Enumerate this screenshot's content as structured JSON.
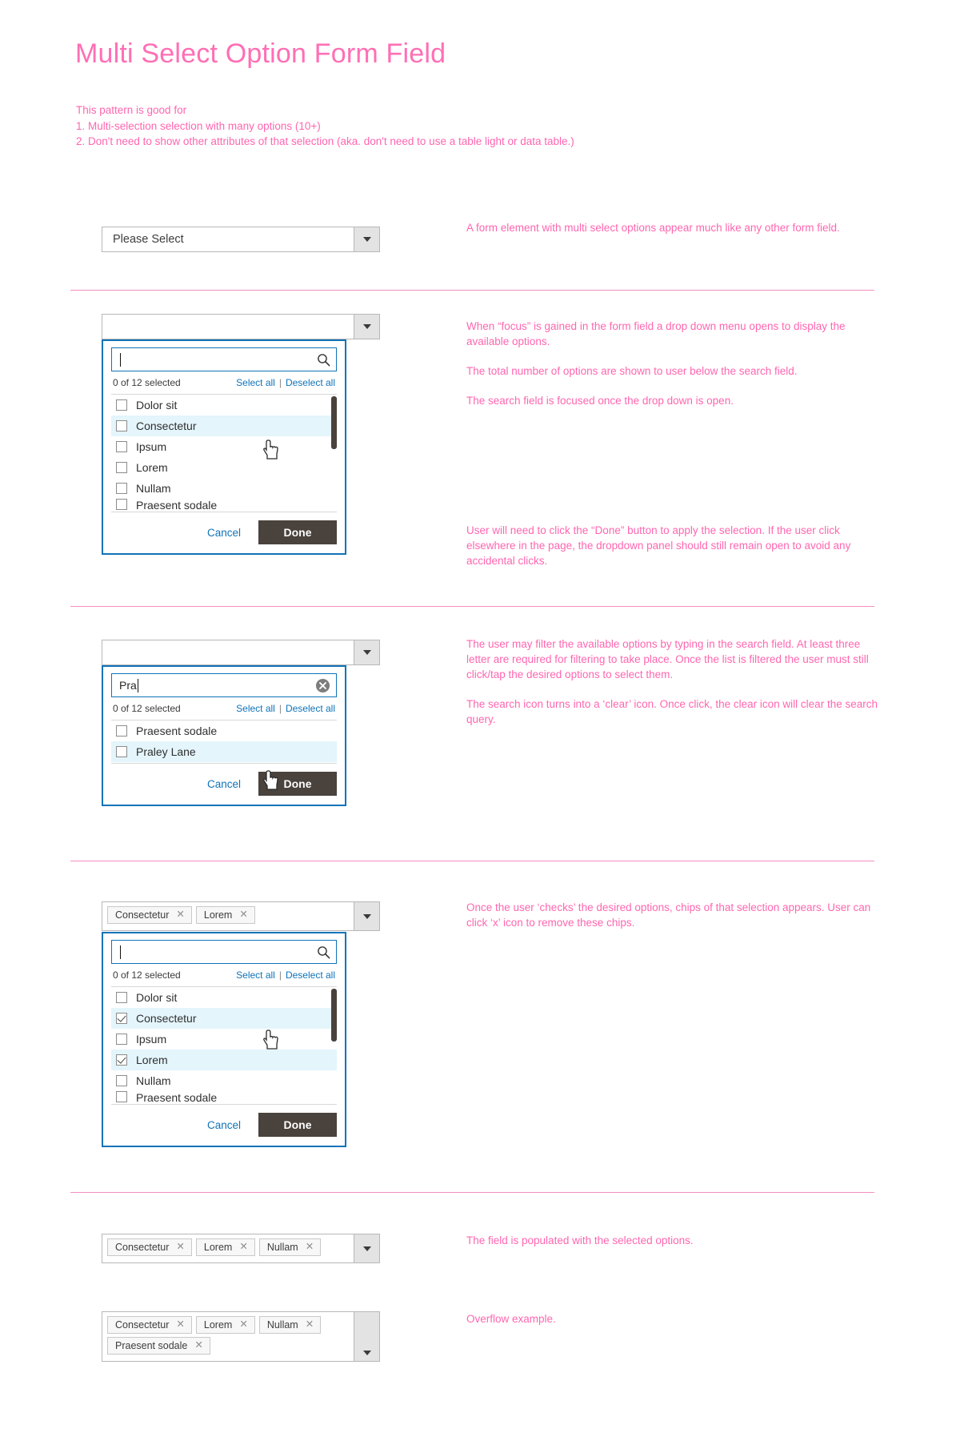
{
  "header": {
    "title": "Multi Select Option Form Field",
    "intro_lines": [
      "This pattern is good for",
      "1. Multi-selection selection with many options (10+)",
      "2. Don't need to show other attributes of that selection (aka. don't need to use a table light or data table.)"
    ]
  },
  "common": {
    "placeholder": "Please Select",
    "count_label": "0 of 12 selected",
    "select_all": "Select all",
    "separator": "|",
    "deselect_all": "Deselect all",
    "cancel": "Cancel",
    "done": "Done",
    "remove_chip": "✕"
  },
  "colors": {
    "accent_pink": "#ff66b0",
    "focus_blue": "#1073b8",
    "link_blue": "#1073b8",
    "done_button": "#4a423c",
    "row_highlight": "#e4f5fb"
  },
  "sections": {
    "closed": {
      "note": "A form element with multi select options appear much like any other form field.",
      "field_value": "Please Select"
    },
    "opened": {
      "search_value": "",
      "notes": [
        "When “focus” is gained in the form field a drop down menu opens to display the available options.",
        "The total number of options are shown to user below the search field.",
        "The search field is focused once the drop down is open."
      ],
      "note_done": "User will need to click the “Done” button to apply the selection. If the user click elsewhere in the page, the dropdown panel should still remain open to avoid any accidental clicks.",
      "options": [
        {
          "label": "Dolor sit",
          "checked": false,
          "highlight": false
        },
        {
          "label": "Consectetur",
          "checked": false,
          "highlight": true
        },
        {
          "label": "Ipsum",
          "checked": false,
          "highlight": false
        },
        {
          "label": "Lorem",
          "checked": false,
          "highlight": false
        },
        {
          "label": "Nullam",
          "checked": false,
          "highlight": false
        },
        {
          "label": "Praesent sodale",
          "checked": false,
          "highlight": false
        }
      ]
    },
    "filtered": {
      "search_value": "Pra",
      "notes": [
        "The user may filter the available options by typing in the search field.  At least three letter are required for filtering to take place.  Once the list is filtered the user must still click/tap the desired options to select them.",
        "The search icon turns into a ‘clear’ icon. Once click, the clear icon will clear the search query."
      ],
      "options": [
        {
          "label": "Praesent sodale",
          "checked": false,
          "highlight": false
        },
        {
          "label": "Praley Lane",
          "checked": false,
          "highlight": true
        }
      ]
    },
    "checked": {
      "note": "Once the user ‘checks’ the desired options, chips of that selection appears. User can click ‘x’ icon to remove these chips.",
      "search_value": "",
      "chips": [
        "Consectetur",
        "Lorem"
      ],
      "options": [
        {
          "label": "Dolor sit",
          "checked": false,
          "highlight": false
        },
        {
          "label": "Consectetur",
          "checked": true,
          "highlight": true
        },
        {
          "label": "Ipsum",
          "checked": false,
          "highlight": false
        },
        {
          "label": "Lorem",
          "checked": true,
          "highlight": true
        },
        {
          "label": "Nullam",
          "checked": false,
          "highlight": false
        },
        {
          "label": "Praesent sodale",
          "checked": false,
          "highlight": false
        }
      ]
    },
    "populated": {
      "note": "The field is populated with the selected options.",
      "chips": [
        "Consectetur",
        "Lorem",
        "Nullam"
      ]
    },
    "overflow": {
      "note": "Overflow example.",
      "chips": [
        "Consectetur",
        "Lorem",
        "Nullam",
        "Praesent sodale"
      ]
    }
  }
}
